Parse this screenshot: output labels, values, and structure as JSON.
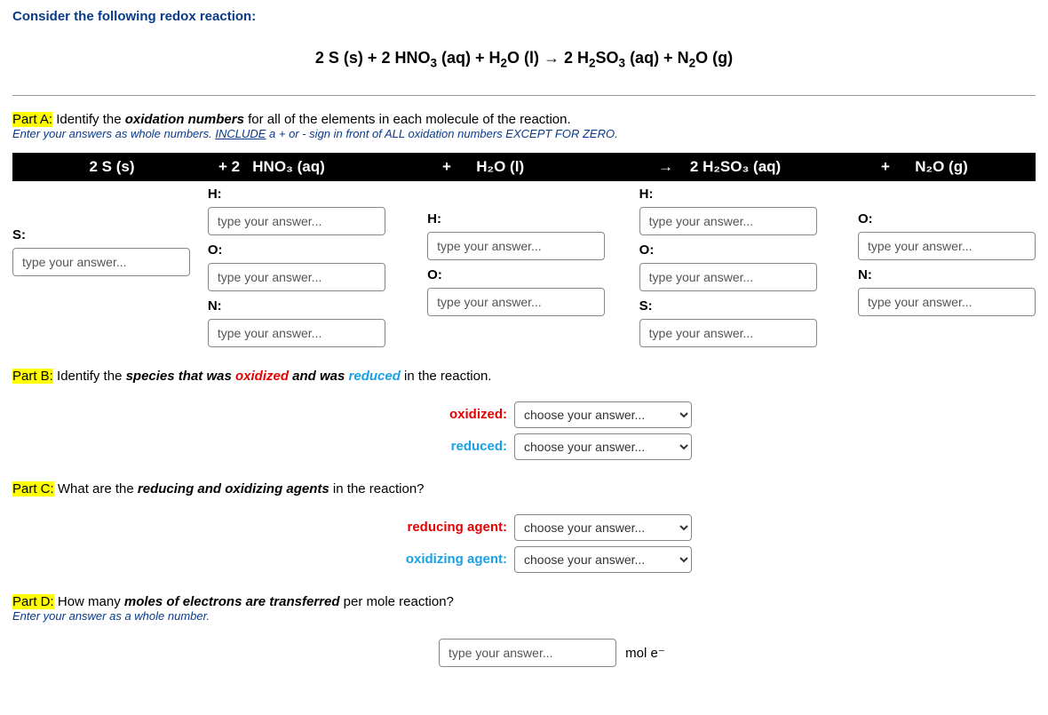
{
  "title": "Consider the following redox reaction:",
  "equation_html": "2 S (s) + 2 HNO<sub>3</sub> (aq) + H<sub>2</sub>O (l) → 2 H<sub>2</sub>SO<sub>3</sub> (aq) + N<sub>2</sub>O (g)",
  "partA": {
    "heading_label": "Part A:",
    "heading_text": " Identify the ",
    "heading_em": "oxidation numbers",
    "heading_tail": " for all of the elements in each molecule of the reaction.",
    "hint": "Enter your answers as whole numbers. ",
    "hint_u": "INCLUDE",
    "hint_tail": " a + or - sign in front of ALL oxidation numbers EXCEPT FOR ZERO."
  },
  "bar": {
    "c1": "2 S (s)",
    "c2a": "+ 2",
    "c2b": "HNO₃ (aq)",
    "c3a": "+",
    "c3b": "H₂O (l)",
    "c4a": "→",
    "c4b": "2 H₂SO₃ (aq)",
    "c5a": "+",
    "c5b": "N₂O (g)"
  },
  "labels": {
    "H": "H:",
    "O": "O:",
    "N": "N:",
    "S": "S:"
  },
  "placeholder": "type your answer...",
  "choose_ph": "choose your answer...",
  "partB": {
    "heading_label": "Part B:",
    "heading_text": " Identify the ",
    "em1": "species that was ",
    "oxidized": "oxidized",
    "mid": " and was ",
    "reduced": "reduced",
    "tail": " in the reaction.",
    "lbl_oxidized": "oxidized:",
    "lbl_reduced": "reduced:"
  },
  "partC": {
    "heading_label": "Part C:",
    "text": " What are the ",
    "em": "reducing and oxidizing agents",
    "tail": " in the reaction?",
    "lbl_reducing": "reducing agent:",
    "lbl_oxidizing": "oxidizing agent:"
  },
  "partD": {
    "heading_label": "Part D:",
    "text": " How many ",
    "em": "moles of electrons are transferred",
    "tail": " per mole reaction?",
    "hint": "Enter your answer as a whole number.",
    "unit": "mol e⁻"
  }
}
